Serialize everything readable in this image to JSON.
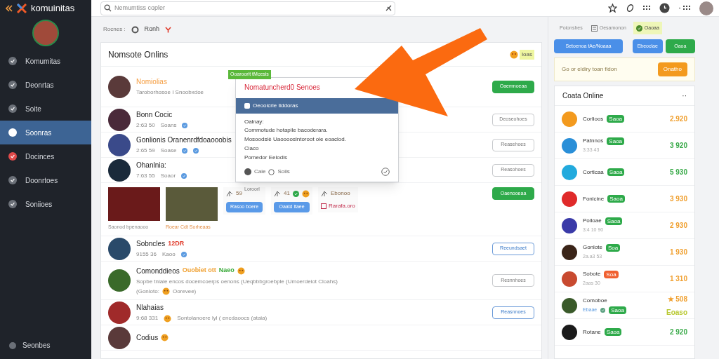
{
  "sidebar": {
    "logo": "komuinitas",
    "items": [
      {
        "label": "Komumitas",
        "selected": false
      },
      {
        "label": "Deonrtas",
        "selected": false
      },
      {
        "label": "Soite",
        "selected": false
      },
      {
        "label": "Soonras",
        "selected": true
      },
      {
        "label": "Docinces",
        "selected": false
      },
      {
        "label": "Doonrtoes",
        "selected": false
      },
      {
        "label": "Soniioes",
        "selected": false
      }
    ],
    "footer": "Seonbes"
  },
  "search": {
    "placeholder": "Nemumtiss copler"
  },
  "filters": {
    "label": "Rocnes :",
    "option": "Ronh"
  },
  "feed": {
    "title": "Nomsote Onlins",
    "badge": "Ioas",
    "rows": [
      {
        "kind": "post",
        "name": "Nomiolias",
        "highlighted": true,
        "meta": [
          "Taroborhosoe I Snoobxdoe"
        ],
        "tag": "Ooaroorlt tMcesis",
        "button": {
          "label": "Oaemnoeaa",
          "kind": "solid"
        }
      },
      {
        "kind": "post",
        "name": "Bonn Cocic",
        "highlighted": false,
        "meta": [
          "2:63 50",
          "Soans"
        ],
        "meta_icons": [
          {
            "kind": "verified"
          }
        ],
        "button": {
          "label": "Deoseohoes",
          "kind": "outline"
        }
      },
      {
        "kind": "post",
        "name": "Gonlionis Oranenrdfdoaooobis",
        "highlighted": false,
        "meta": [
          "2:65 59",
          "Soase"
        ],
        "meta_icons": [
          {
            "kind": "verified"
          },
          {
            "kind": "verified"
          }
        ],
        "button": {
          "label": "Reasehoes",
          "kind": "outline"
        }
      },
      {
        "kind": "post",
        "name": "Ohanlnia:",
        "highlighted": false,
        "meta": [
          "7:63 55",
          "Soaor"
        ],
        "meta_icons": [
          {
            "kind": "verified"
          }
        ],
        "button": {
          "label": "Reasohoes",
          "kind": "outline"
        }
      },
      {
        "kind": "media",
        "captions": [
          "Saonod bpenaooo",
          "Roear Cdt Sorheaas"
        ],
        "cards": [
          {
            "kind": "button",
            "count": "59",
            "label": "Rasoo boere"
          },
          {
            "kind": "button",
            "count": "41",
            "label": "Oaatd ltaee"
          },
          {
            "kind": "link",
            "count": "Ebonoo",
            "label": "Rarafa.oro"
          }
        ],
        "button": {
          "label": "Oaenooeaa",
          "kind": "solid"
        }
      },
      {
        "kind": "post",
        "name": "Sobncles",
        "highlighted": false,
        "extra": "12DR",
        "meta": [
          "9155 36",
          "Kaoo"
        ],
        "meta_icons": [
          {
            "kind": "verified"
          }
        ],
        "button": {
          "label": "Reeundsaet",
          "kind": "blue"
        }
      },
      {
        "kind": "post",
        "name": "Comonddieos",
        "highlighted": false,
        "extra": "Ouobiet ott",
        "extra2": "Naeo",
        "name_icons": [
          {
            "kind": "emoji"
          }
        ],
        "meta": [
          "Sopbe tniale encos docemcoerps oenons (Ueqbbbgroebple (Umoerdeiot Cloahs)"
        ],
        "line2": [
          "(Gonloto:",
          "Oorevee)"
        ],
        "button": {
          "label": "Resnnhoes",
          "kind": "outline"
        }
      },
      {
        "kind": "post",
        "name": "Nlahaias",
        "highlighted": false,
        "meta": [
          "9:68 331"
        ],
        "note": "Sontolanoere lyl ( encdaoocs (ataia)",
        "button": {
          "label": "Reasnnoes",
          "kind": "blue"
        }
      },
      {
        "kind": "post",
        "name": "Codius",
        "highlighted": false,
        "name_icons": [
          {
            "kind": "emoji"
          }
        ]
      }
    ]
  },
  "popup": {
    "title": "Nomatuncherd0 Senoes",
    "highlight": "Oeooicrie liddoras",
    "heading": "Oalnay:",
    "lines": [
      "Commotude hotapile bacoderara.",
      "Mosoodsiè Uaooooslntoroot ole eoaclod.",
      "Ciaco",
      "Pomedor Eelodis"
    ],
    "actions": [
      "Caie",
      "Soiis"
    ],
    "below": "Loroorl"
  },
  "right": {
    "tabs": [
      {
        "label": "Poionshes",
        "selected": false
      },
      {
        "label": "Oesamonon",
        "selected": false
      },
      {
        "label": "Oaoaa",
        "selected": true
      }
    ],
    "buttons": [
      {
        "label": "Setoenoa tAe/Noaaa",
        "color": "#4a8fe8"
      },
      {
        "label": "Ebeoclae",
        "color": "#4a8fe8"
      },
      {
        "label": "Oaoa",
        "color": "#2eaa4a"
      }
    ],
    "notice": {
      "text": "Go or eldiry toan fidon",
      "button": "Onatho"
    },
    "online": {
      "title": "Coata Online",
      "more": "··",
      "items": [
        {
          "name": "Corlioos",
          "tag": {
            "text": "Saoa",
            "color": "#2eaa4a"
          },
          "values": [
            {
              "text": "2.920",
              "color": "#f0a030"
            }
          ]
        },
        {
          "name": "Patnnos",
          "sub": "3:33 43",
          "tag": {
            "text": "Saoa",
            "color": "#2eaa4a"
          },
          "values": [
            {
              "text": "3 920",
              "color": "#3aaa4a"
            }
          ]
        },
        {
          "name": "Cortlcaa",
          "tag": {
            "text": "Saoa",
            "color": "#2eaa4a"
          },
          "values": [
            {
              "text": "5 930",
              "color": "#3aaa4a"
            }
          ]
        },
        {
          "name": "Fonlcine",
          "tag": {
            "text": "Saoa",
            "color": "#2eaa4a"
          },
          "values": [
            {
              "text": "3 930",
              "color": "#f0a030"
            }
          ]
        },
        {
          "name": "Poiloae",
          "sub": "3:4 10 90",
          "tag": {
            "text": "Saoa",
            "color": "#2eaa4a"
          },
          "values": [
            {
              "text": "2 930",
              "color": "#f0a030"
            }
          ]
        },
        {
          "name": "Gonlote",
          "sub": "2a.a3 53",
          "tag": {
            "text": "Soa",
            "color": "#2eaa4a"
          },
          "values": [
            {
              "text": "1 930",
              "color": "#f0a030"
            }
          ]
        },
        {
          "name": "Sobote",
          "sub": "2aas 30",
          "tag": {
            "text": "Soa",
            "color": "#f06030"
          },
          "values": [
            {
              "text": "1 310",
              "color": "#f0a030"
            }
          ]
        },
        {
          "name": "Comoboe",
          "sub": "Ebaae",
          "tag": {
            "text": "Saoa",
            "color": "#2eaa4a"
          },
          "values": [
            {
              "text": "★ 508",
              "color": "#f0a030"
            },
            {
              "text": "Eoaso",
              "color": "#b8c830"
            }
          ]
        },
        {
          "name": "Rotane",
          "tag": {
            "text": "Saoa",
            "color": "#2eaa4a"
          },
          "values": [
            {
              "text": "2 920",
              "color": "#3aaa4a"
            }
          ]
        }
      ]
    }
  }
}
